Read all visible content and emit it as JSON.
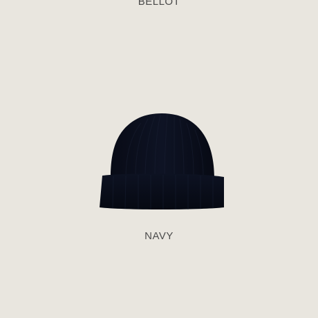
{
  "product": {
    "brand": "BELLOT",
    "color_name": "NAVY",
    "image_icon": "knit-beanie",
    "colors": {
      "background": "#e9e6df",
      "beanie": "#0b0f1e",
      "text": "#4a4a4a"
    }
  }
}
